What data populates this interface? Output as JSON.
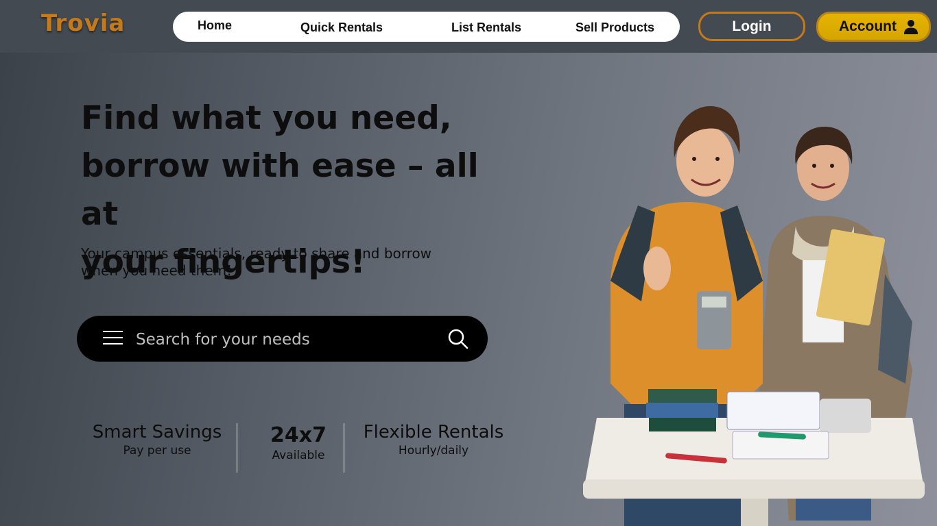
{
  "brand": {
    "name": "Trovia",
    "color": "#c47a1a"
  },
  "nav": {
    "items": [
      {
        "label": "Home"
      },
      {
        "label": "Quick Rentals"
      },
      {
        "label": "List Rentals"
      },
      {
        "label": "Sell Products"
      }
    ]
  },
  "auth": {
    "login_label": "Login",
    "account_label": "Account",
    "account_icon": "user-icon",
    "account_color": "#e6b400"
  },
  "hero": {
    "title": "Find what you need,\nborrow with ease – all at\n your fingertips!",
    "subtitle": "Your campus essentials, ready to share and borrow when you need them!"
  },
  "search": {
    "placeholder": "Search for your needs",
    "value": "",
    "menu_icon": "menu-icon",
    "search_icon": "search-icon"
  },
  "stats": [
    {
      "title": "Smart Savings",
      "subtitle": "Pay per use"
    },
    {
      "title": "24x7",
      "subtitle": "Available"
    },
    {
      "title": "Flexible Rentals",
      "subtitle": "Hourly/daily"
    }
  ]
}
